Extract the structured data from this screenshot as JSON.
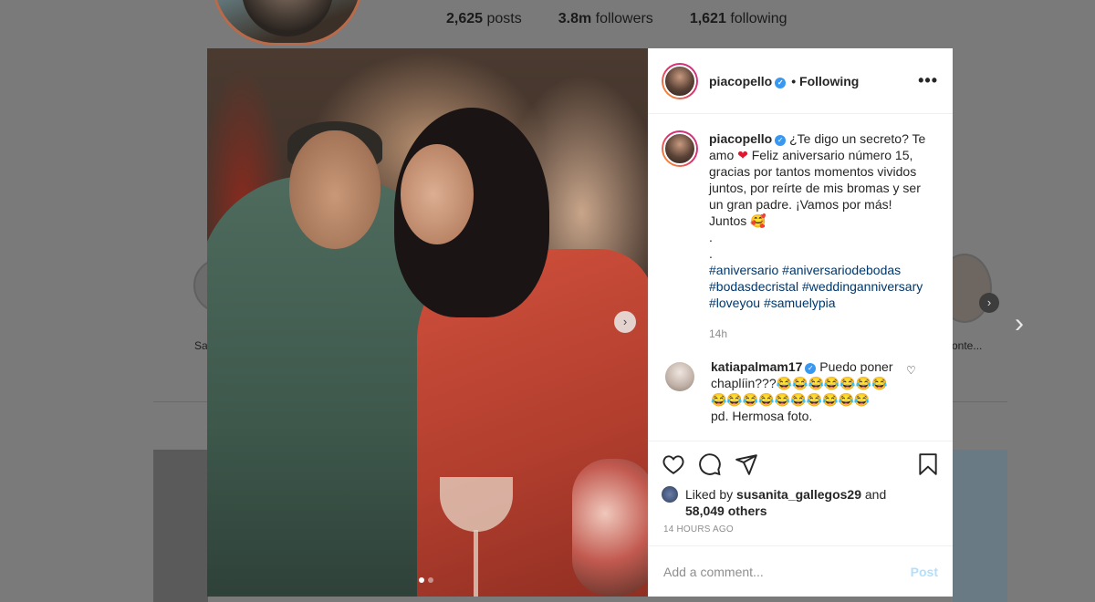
{
  "background": {
    "stats": [
      {
        "value": "2,625",
        "label": "posts"
      },
      {
        "value": "3.8m",
        "label": "followers"
      },
      {
        "value": "1,621",
        "label": "following"
      }
    ],
    "story_labels": [
      "Sa",
      "onte..."
    ]
  },
  "post": {
    "username": "piacopello",
    "follow_status": "• Following",
    "more_icon": "more-horizontal-icon",
    "caption": {
      "username": "piacopello",
      "text_before_heart": "¿Te digo un secreto? Te amo",
      "heart": "❤",
      "text_after_heart": "Feliz aniversario número 15, gracias por tantos momentos vividos juntos, por reírte de mis bromas y ser un gran padre. ¡Vamos por más! Juntos",
      "emoji": "🥰",
      "dot1": ".",
      "dot2": ".",
      "hashtags": [
        "#aniversario",
        "#aniversariodebodas",
        "#bodasdecristal",
        "#weddinganniversary",
        "#loveyou",
        "#samuelypia"
      ],
      "time": "14h"
    },
    "comments": [
      {
        "username": "katiapalmam17",
        "text_line1": "Puedo poner chaplíin???😂😂😂😂😂😂😂",
        "text_line2": "😂😂😂😂😂😂😂😂😂😂",
        "text_line3": "pd. Hermosa foto."
      }
    ],
    "likes": {
      "prefix": "Liked by",
      "user": "susanita_gallegos29",
      "and": "and",
      "others": "58,049 others"
    },
    "timestamp": "14 HOURS AGO",
    "add_comment_placeholder": "Add a comment...",
    "post_button": "Post"
  },
  "colors": {
    "accent": "#3897f0",
    "post_disabled": "#b2dffc",
    "hashtag": "#00376b",
    "heart": "#e0182f"
  }
}
